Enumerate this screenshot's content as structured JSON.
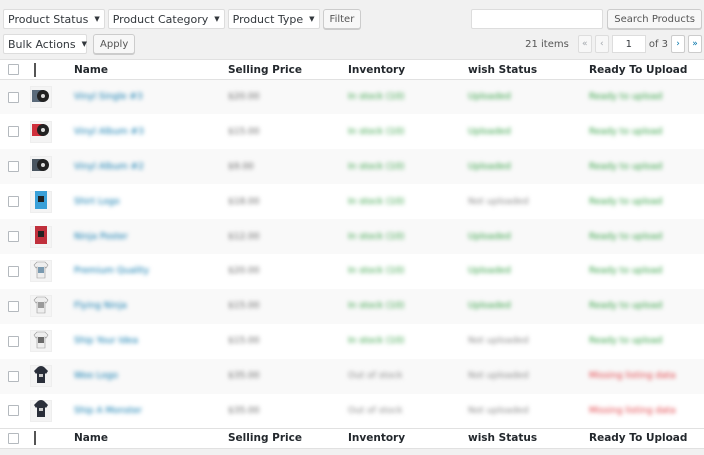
{
  "filters": {
    "product_status": "Product Status",
    "product_category": "Product Category",
    "product_type": "Product Type",
    "filter_button": "Filter"
  },
  "search": {
    "value": "",
    "button": "Search Products"
  },
  "bulk": {
    "select": "Bulk Actions",
    "apply": "Apply"
  },
  "pagination": {
    "items": "21 items",
    "first": "«",
    "prev": "‹",
    "current": "1",
    "of_total": "of 3",
    "next": "›",
    "last": "»"
  },
  "columns": {
    "name": "Name",
    "selling_price": "Selling Price",
    "inventory": "Inventory",
    "wish_status": "wish Status",
    "ready_to_upload": "Ready To Upload"
  },
  "colors": {
    "link": "#0073aa",
    "ok": "#2e9e3f",
    "bad": "#e0383e"
  },
  "rows": [
    {
      "thumb_color": "#5a6a7a",
      "thumb_icon": "vinyl-record-icon",
      "name": "Vinyl Single #3",
      "price": "$20.00",
      "inventory": "In stock (10)",
      "inventory_ok": true,
      "wish": "Uploaded",
      "wish_ok": true,
      "ready": "Ready to upload",
      "ready_ok": true
    },
    {
      "thumb_color": "#d0303c",
      "thumb_icon": "vinyl-record-icon",
      "name": "Vinyl Album #3",
      "price": "$15.00",
      "inventory": "In stock (10)",
      "inventory_ok": true,
      "wish": "Uploaded",
      "wish_ok": true,
      "ready": "Ready to upload",
      "ready_ok": true
    },
    {
      "thumb_color": "#4a5560",
      "thumb_icon": "vinyl-record-icon",
      "name": "Vinyl Album #2",
      "price": "$9.00",
      "inventory": "In stock (10)",
      "inventory_ok": true,
      "wish": "Uploaded",
      "wish_ok": true,
      "ready": "Ready to upload",
      "ready_ok": true
    },
    {
      "thumb_color": "#3aa0d8",
      "thumb_icon": "poster-icon",
      "name": "Shirt Logo",
      "price": "$18.00",
      "inventory": "In stock (10)",
      "inventory_ok": true,
      "wish": "Not uploaded",
      "wish_ok": false,
      "ready": "Ready to upload",
      "ready_ok": true
    },
    {
      "thumb_color": "#c0303c",
      "thumb_icon": "poster-icon",
      "name": "Ninja Poster",
      "price": "$12.00",
      "inventory": "In stock (10)",
      "inventory_ok": true,
      "wish": "Uploaded",
      "wish_ok": true,
      "ready": "Ready to upload",
      "ready_ok": true
    },
    {
      "thumb_color": "#7a9ab0",
      "thumb_icon": "tshirt-icon",
      "name": "Premium Quality",
      "price": "$20.00",
      "inventory": "In stock (10)",
      "inventory_ok": true,
      "wish": "Uploaded",
      "wish_ok": true,
      "ready": "Ready to upload",
      "ready_ok": true
    },
    {
      "thumb_color": "#9a9a9a",
      "thumb_icon": "tshirt-icon",
      "name": "Flying Ninja",
      "price": "$15.00",
      "inventory": "In stock (10)",
      "inventory_ok": true,
      "wish": "Uploaded",
      "wish_ok": true,
      "ready": "Ready to upload",
      "ready_ok": true
    },
    {
      "thumb_color": "#6a6a6a",
      "thumb_icon": "tshirt-icon",
      "name": "Ship Your Idea",
      "price": "$15.00",
      "inventory": "In stock (10)",
      "inventory_ok": true,
      "wish": "Not uploaded",
      "wish_ok": false,
      "ready": "Ready to upload",
      "ready_ok": true
    },
    {
      "thumb_color": "#2a2f3a",
      "thumb_icon": "hoodie-icon",
      "name": "Woo Logo",
      "price": "$35.00",
      "inventory": "Out of stock",
      "inventory_ok": false,
      "wish": "Not uploaded",
      "wish_ok": false,
      "ready": "Missing listing data",
      "ready_ok": false
    },
    {
      "thumb_color": "#2a2f3a",
      "thumb_icon": "hoodie-icon",
      "name": "Ship A Monster",
      "price": "$35.00",
      "inventory": "Out of stock",
      "inventory_ok": false,
      "wish": "Not uploaded",
      "wish_ok": false,
      "ready": "Missing listing data",
      "ready_ok": false
    }
  ]
}
